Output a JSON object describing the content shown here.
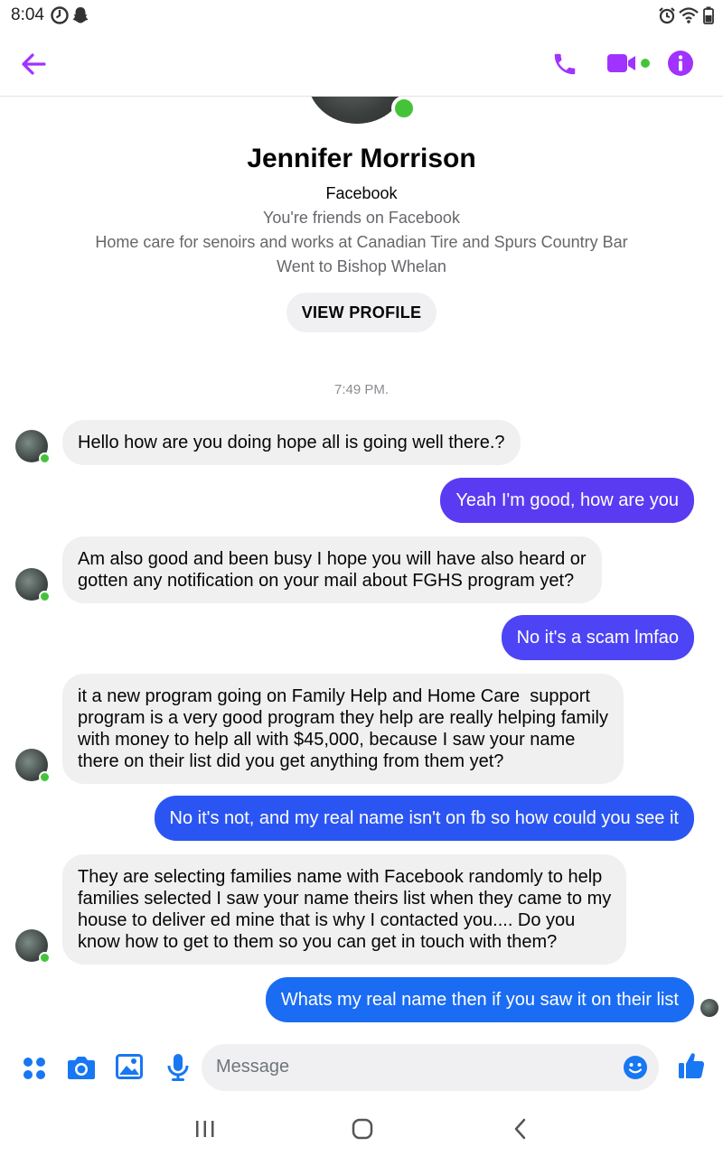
{
  "status_bar": {
    "time": "8:04"
  },
  "header": {
    "back_icon": "arrow-left-icon",
    "call_icon": "phone-icon",
    "video_icon": "video-camera-icon",
    "info_icon": "info-icon",
    "accent": "#a033ff"
  },
  "profile": {
    "name": "Jennifer Morrison",
    "source": "Facebook",
    "friends": "You're friends on Facebook",
    "work": "Home care for senoirs and works at Canadian Tire and Spurs Country Bar",
    "education": "Went to Bishop Whelan",
    "view_profile": "VIEW PROFILE"
  },
  "conversation": {
    "timestamp": "7:49 PM.",
    "messages": [
      {
        "from": "them",
        "lines": [
          "Hello how are you doing hope all is going well there.?"
        ]
      },
      {
        "from": "me",
        "lines": [
          "Yeah I'm good, how are you"
        ],
        "color": "#5b3bf2"
      },
      {
        "from": "them",
        "lines": [
          "Am also good and been busy I hope you will have also heard or",
          "gotten any notification on your mail about FGHS program yet?"
        ]
      },
      {
        "from": "me",
        "lines": [
          "No it's a scam lmfao"
        ],
        "color": "#4d44f5"
      },
      {
        "from": "them",
        "lines": [
          "it a new program going on Family Help and Home Care  support",
          "program is a very good program they help are really helping family",
          "with money to help all with $45,000, because I saw your name",
          "there on their list did you get anything from them yet?"
        ]
      },
      {
        "from": "me",
        "lines": [
          "No it's not, and my real name isn't on fb so how could you see it"
        ],
        "color": "#2b55f3"
      },
      {
        "from": "them",
        "lines": [
          "They are selecting families name with Facebook randomly to help",
          "families selected I saw your name theirs list when they came to my",
          "house to deliver ed mine that is why I contacted you.... Do you",
          "know how to get to them so you can get in touch with them?"
        ]
      },
      {
        "from": "me",
        "lines": [
          "Whats my real name then if you saw it on their list"
        ],
        "color": "#1a6cf2"
      }
    ]
  },
  "composer": {
    "placeholder": "Message",
    "icons": [
      "menu-dots-icon",
      "camera-icon",
      "image-icon",
      "microphone-icon",
      "emoji-icon",
      "thumbs-up-icon"
    ],
    "accent": "#1877f2"
  },
  "navbar": {
    "icons": [
      "recent-apps-icon",
      "home-icon",
      "back-icon"
    ]
  }
}
